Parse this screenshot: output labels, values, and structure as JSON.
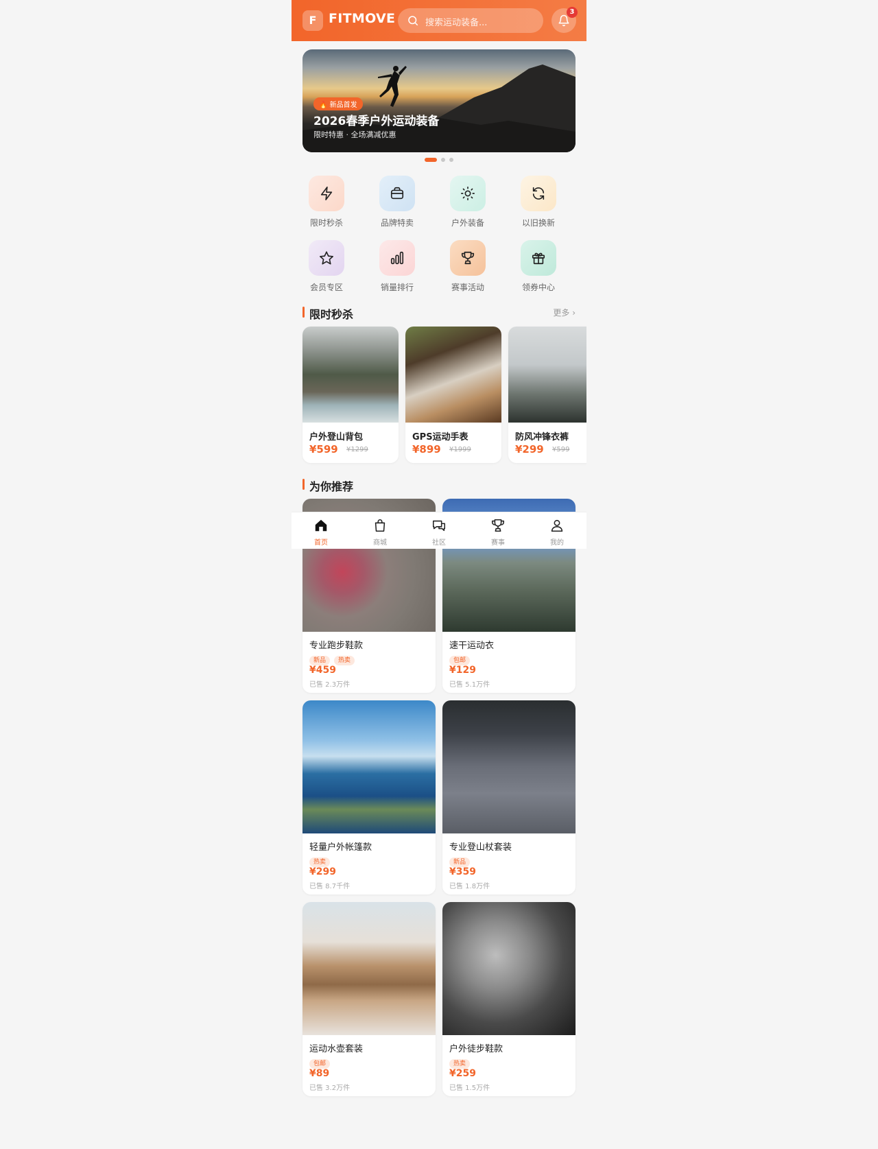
{
  "header": {
    "logo_letter": "F",
    "brand": "FITMOVE",
    "search_placeholder": "搜索运动装备...",
    "notification_count": "3"
  },
  "banner": {
    "tag": "🔥 新品首发",
    "title": "2026春季户外运动装备",
    "subtitle": "限时特惠 · 全场满减优惠",
    "indicator_count": 3,
    "active_index": 0
  },
  "quick_entries": [
    {
      "label": "限时秒杀",
      "icon": "lightning-icon",
      "bg": "#fde5dc"
    },
    {
      "label": "品牌特卖",
      "icon": "briefcase-icon",
      "bg": "#dcebf7"
    },
    {
      "label": "户外装备",
      "icon": "sun-icon",
      "bg": "#ddf4ee"
    },
    {
      "label": "以旧换新",
      "icon": "refresh-icon",
      "bg": "#fdf0dc"
    },
    {
      "label": "会员专区",
      "icon": "star-icon",
      "bg": "#ece3f4"
    },
    {
      "label": "销量排行",
      "icon": "bar-chart-icon",
      "bg": "#fde2e2"
    },
    {
      "label": "赛事活动",
      "icon": "trophy-icon",
      "bg": "#f8d4b4"
    },
    {
      "label": "领券中心",
      "icon": "gift-icon",
      "bg": "#ccefe4"
    }
  ],
  "flash_sale": {
    "title": "限时秒杀",
    "more": "更多 ›",
    "items": [
      {
        "name": "户外登山背包",
        "price": "¥599",
        "old_price": "¥1299"
      },
      {
        "name": "GPS运动手表",
        "price": "¥899",
        "old_price": "¥1999"
      },
      {
        "name": "防风冲锋衣裤",
        "price": "¥299",
        "old_price": "¥599"
      }
    ]
  },
  "recommend": {
    "title": "为你推荐",
    "items": [
      {
        "name": "专业跑步鞋款",
        "tags": [
          "新品",
          "热卖"
        ],
        "price": "¥459",
        "sold": "已售 2.3万件"
      },
      {
        "name": "速干运动衣",
        "tags": [
          "包邮"
        ],
        "price": "¥129",
        "sold": "已售 5.1万件"
      },
      {
        "name": "轻量户外帐篷款",
        "tags": [
          "热卖"
        ],
        "price": "¥299",
        "sold": "已售 8.7千件"
      },
      {
        "name": "专业登山杖套装",
        "tags": [
          "新品"
        ],
        "price": "¥359",
        "sold": "已售 1.8万件"
      },
      {
        "name": "运动水壶套装",
        "tags": [
          "包邮"
        ],
        "price": "¥89",
        "sold": "已售 3.2万件"
      },
      {
        "name": "户外徒步鞋款",
        "tags": [
          "热卖"
        ],
        "price": "¥259",
        "sold": "已售 1.5万件"
      }
    ]
  },
  "tabbar": {
    "active": "home",
    "tabs": [
      {
        "key": "home",
        "label": "首页",
        "icon": "home-icon"
      },
      {
        "key": "shop",
        "label": "商城",
        "icon": "shopping-bag-icon"
      },
      {
        "key": "community",
        "label": "社区",
        "icon": "chat-icon"
      },
      {
        "key": "events",
        "label": "赛事",
        "icon": "trophy-icon"
      },
      {
        "key": "me",
        "label": "我的",
        "icon": "user-icon"
      }
    ]
  },
  "colors": {
    "accent": "#f2652a",
    "badge": "#e53935"
  }
}
